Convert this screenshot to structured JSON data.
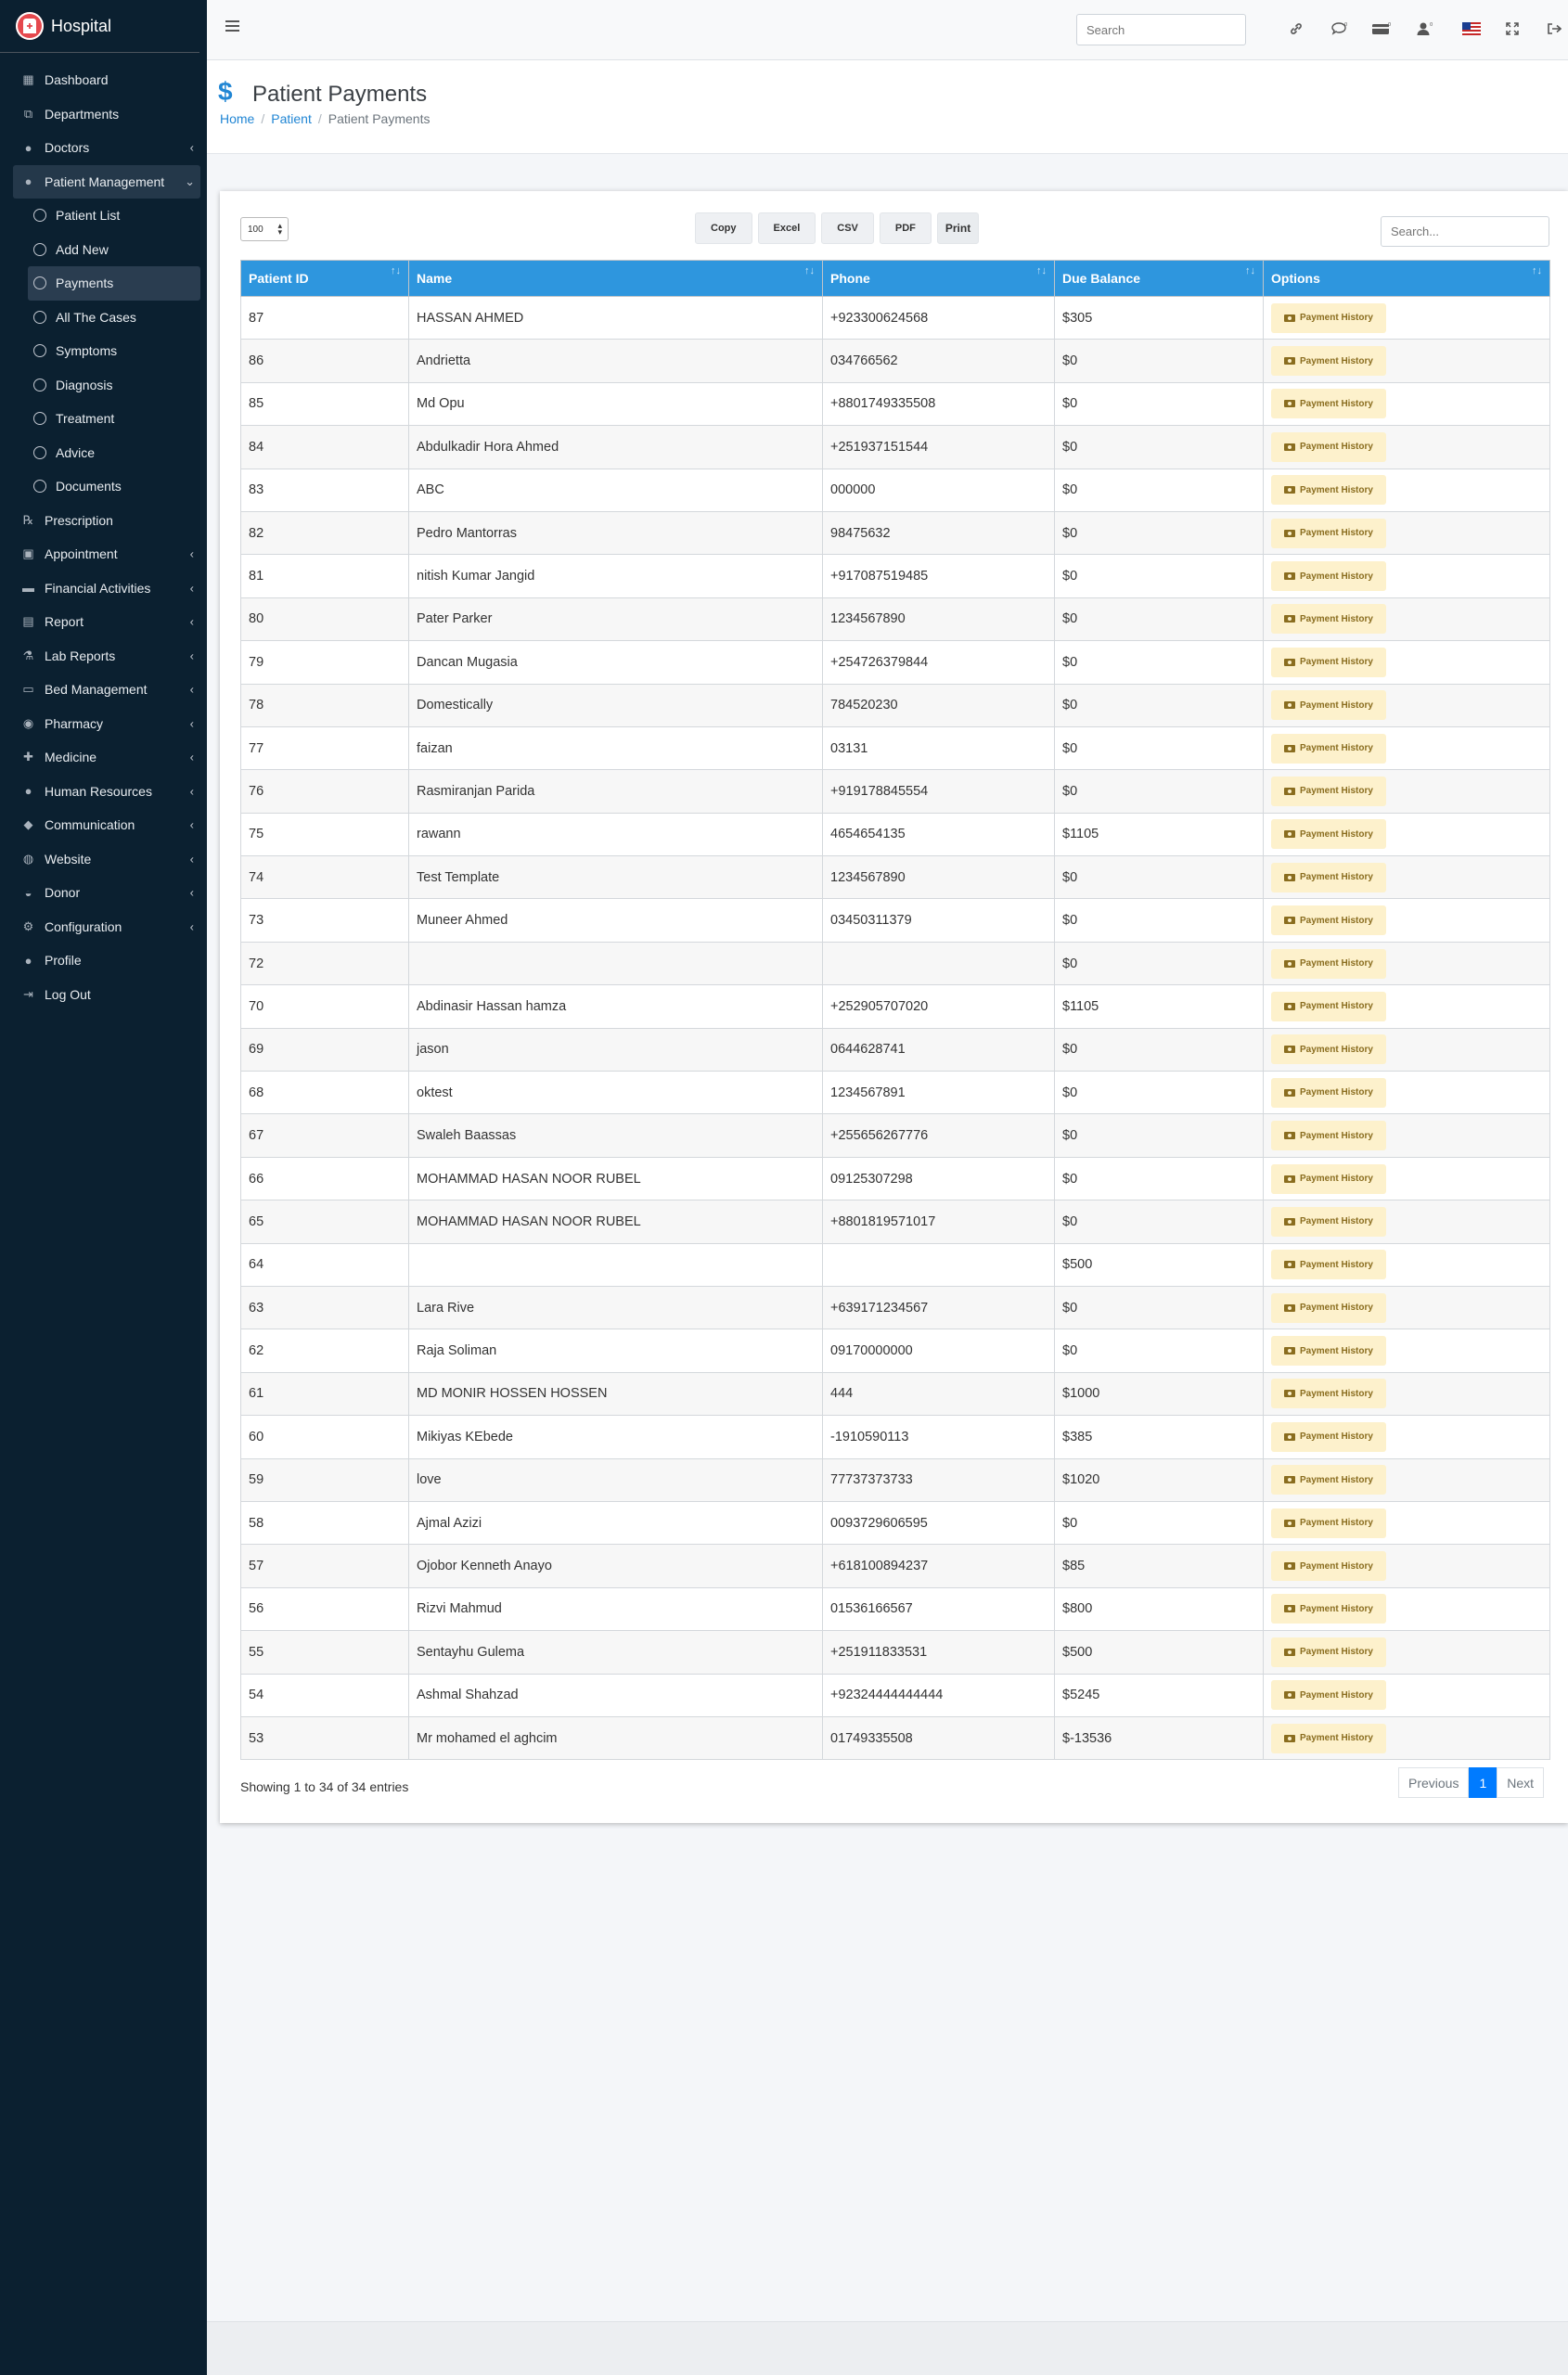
{
  "brand": {
    "name": "Hospital"
  },
  "sidebar": {
    "items": [
      {
        "label": "Dashboard",
        "icon": "grid-icon",
        "chevron": false
      },
      {
        "label": "Departments",
        "icon": "sitemap-icon",
        "chevron": false
      },
      {
        "label": "Doctors",
        "icon": "user-md-icon",
        "chevron": true
      },
      {
        "label": "Patient Management",
        "icon": "user-icon",
        "chevron": true,
        "open": true
      },
      {
        "label": "Patient List",
        "sub": true
      },
      {
        "label": "Add New",
        "sub": true
      },
      {
        "label": "Payments",
        "sub": true,
        "active": true
      },
      {
        "label": "All The Cases",
        "sub": true
      },
      {
        "label": "Symptoms",
        "sub": true
      },
      {
        "label": "Diagnosis",
        "sub": true
      },
      {
        "label": "Treatment",
        "sub": true
      },
      {
        "label": "Advice",
        "sub": true
      },
      {
        "label": "Documents",
        "sub": true
      },
      {
        "label": "Prescription",
        "icon": "prescription-icon",
        "chevron": false
      },
      {
        "label": "Appointment",
        "icon": "calendar-check-icon",
        "chevron": true
      },
      {
        "label": "Financial Activities",
        "icon": "money-icon",
        "chevron": true
      },
      {
        "label": "Report",
        "icon": "file-icon",
        "chevron": true
      },
      {
        "label": "Lab Reports",
        "icon": "flask-icon",
        "chevron": true
      },
      {
        "label": "Bed Management",
        "icon": "bed-icon",
        "chevron": true
      },
      {
        "label": "Pharmacy",
        "icon": "pills-icon",
        "chevron": true
      },
      {
        "label": "Medicine",
        "icon": "medkit-icon",
        "chevron": true
      },
      {
        "label": "Human Resources",
        "icon": "users-icon",
        "chevron": true
      },
      {
        "label": "Communication",
        "icon": "comments-icon",
        "chevron": true
      },
      {
        "label": "Website",
        "icon": "globe-icon",
        "chevron": true
      },
      {
        "label": "Donor",
        "icon": "hand-holding-icon",
        "chevron": true
      },
      {
        "label": "Configuration",
        "icon": "gear-icon",
        "chevron": true
      },
      {
        "label": "Profile",
        "icon": "user-icon",
        "chevron": false
      },
      {
        "label": "Log Out",
        "icon": "sign-out-icon",
        "chevron": false
      }
    ]
  },
  "topbar": {
    "search_placeholder": "Search"
  },
  "header": {
    "title": "Patient Payments",
    "breadcrumb": {
      "home": "Home",
      "patient": "Patient",
      "current": "Patient Payments"
    }
  },
  "table_tools": {
    "page_length": "100",
    "buttons": {
      "copy": "Copy",
      "excel": "Excel",
      "csv": "CSV",
      "pdf": "PDF",
      "print": "Print"
    },
    "search_placeholder": "Search..."
  },
  "table": {
    "columns": [
      "Patient ID",
      "Name",
      "Phone",
      "Due Balance",
      "Options"
    ],
    "action_label": "Payment History",
    "rows": [
      [
        "87",
        "HASSAN AHMED",
        "+923300624568",
        "$305"
      ],
      [
        "86",
        "Andrietta",
        "034766562",
        "$0"
      ],
      [
        "85",
        "Md Opu",
        "+8801749335508",
        "$0"
      ],
      [
        "84",
        "Abdulkadir Hora Ahmed",
        "+251937151544",
        "$0"
      ],
      [
        "83",
        "ABC",
        "000000",
        "$0"
      ],
      [
        "82",
        "Pedro Mantorras",
        "98475632",
        "$0"
      ],
      [
        "81",
        "nitish Kumar Jangid",
        "+917087519485",
        "$0"
      ],
      [
        "80",
        "Pater Parker",
        "1234567890",
        "$0"
      ],
      [
        "79",
        "Dancan Mugasia",
        "+254726379844",
        "$0"
      ],
      [
        "78",
        "Domestically",
        "784520230",
        "$0"
      ],
      [
        "77",
        "faizan",
        "03131",
        "$0"
      ],
      [
        "76",
        "Rasmiranjan Parida",
        "+919178845554",
        "$0"
      ],
      [
        "75",
        "rawann",
        "4654654135",
        "$1105"
      ],
      [
        "74",
        "Test Template",
        "1234567890",
        "$0"
      ],
      [
        "73",
        "Muneer Ahmed",
        "03450311379",
        "$0"
      ],
      [
        "72",
        "",
        "",
        "$0"
      ],
      [
        "70",
        "Abdinasir Hassan hamza",
        "+252905707020",
        "$1105"
      ],
      [
        "69",
        "jason",
        "0644628741",
        "$0"
      ],
      [
        "68",
        "oktest",
        "1234567891",
        "$0"
      ],
      [
        "67",
        "Swaleh Baassas",
        "+255656267776",
        "$0"
      ],
      [
        "66",
        "MOHAMMAD HASAN NOOR RUBEL",
        "09125307298",
        "$0"
      ],
      [
        "65",
        "MOHAMMAD HASAN NOOR RUBEL",
        "+8801819571017",
        "$0"
      ],
      [
        "64",
        "",
        "",
        "$500"
      ],
      [
        "63",
        "Lara Rive",
        "+639171234567",
        "$0"
      ],
      [
        "62",
        "Raja Soliman",
        "09170000000",
        "$0"
      ],
      [
        "61",
        "MD MONIR HOSSEN HOSSEN",
        "444",
        "$1000"
      ],
      [
        "60",
        "Mikiyas KEbede",
        "-1910590113",
        "$385"
      ],
      [
        "59",
        "love",
        "77737373733",
        "$1020"
      ],
      [
        "58",
        "Ajmal Azizi",
        "0093729606595",
        "$0"
      ],
      [
        "57",
        "Ojobor Kenneth Anayo",
        "+618100894237",
        "$85"
      ],
      [
        "56",
        "Rizvi Mahmud",
        "01536166567",
        "$800"
      ],
      [
        "55",
        "Sentayhu Gulema",
        "+251911833531",
        "$500"
      ],
      [
        "54",
        "Ashmal Shahzad",
        "+92324444444444",
        "$5245"
      ],
      [
        "53",
        "Mr mohamed el aghcim",
        "01749335508",
        "$-13536"
      ]
    ]
  },
  "footer_info": "Showing 1 to 34 of 34 entries",
  "pagination": {
    "previous": "Previous",
    "current": "1",
    "next": "Next"
  },
  "colors": {
    "sidebar_bg": "#0b2030",
    "table_header": "#2e96de",
    "accent": "#007bff",
    "action_button_bg": "#fdf1cc"
  }
}
